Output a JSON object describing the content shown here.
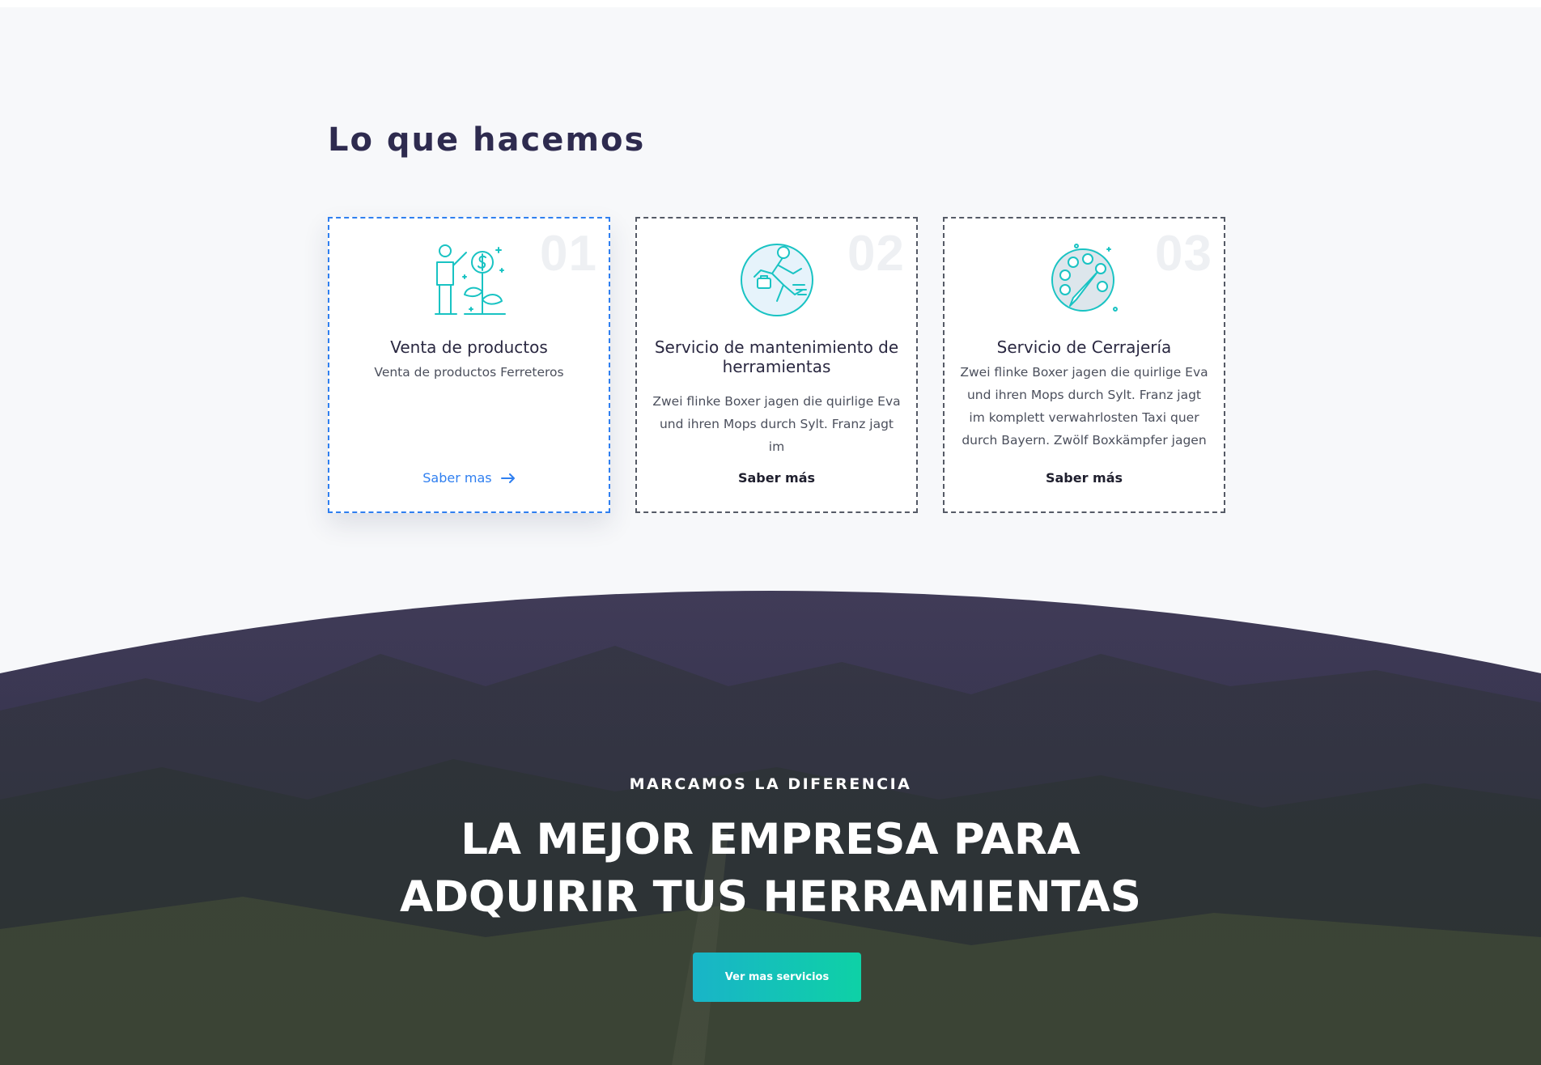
{
  "section": {
    "title": "Lo que hacemos"
  },
  "cards": [
    {
      "number": "01",
      "icon": "growth-person-icon",
      "title": "Venta de productos",
      "description": "Venta de productos Ferreteros",
      "link": "Saber mas",
      "link_icon": "arrow-right-icon",
      "active": true
    },
    {
      "number": "02",
      "icon": "running-businessman-icon",
      "title": "Servicio de mantenimiento de herramientas",
      "description": "Zwei flinke Boxer jagen die quirlige Eva und ihren Mops durch Sylt. Franz jagt im",
      "link": "Saber más",
      "active": false
    },
    {
      "number": "03",
      "icon": "paint-palette-icon",
      "title": "Servicio de Cerrajería",
      "description": "Zwei flinke Boxer jagen die quirlige Eva und ihren Mops durch Sylt. Franz jagt im komplett verwahrlosten Taxi quer durch Bayern. Zwölf Boxkämpfer jagen",
      "link": "Saber más",
      "active": false
    }
  ],
  "hero": {
    "eyebrow": "MARCAMOS LA DIFERENCIA",
    "headline_line1": "LA MEJOR EMPRESA PARA",
    "headline_line2": "ADQUIRIR TUS HERRAMIENTAS",
    "cta": "Ver mas servicios"
  },
  "colors": {
    "accent_blue": "#2f7ff0",
    "icon_teal": "#19c3c3",
    "cta_gradient_start": "#19b4c8",
    "cta_gradient_end": "#0ed1a6",
    "heading_dark": "#2e2b4f"
  }
}
